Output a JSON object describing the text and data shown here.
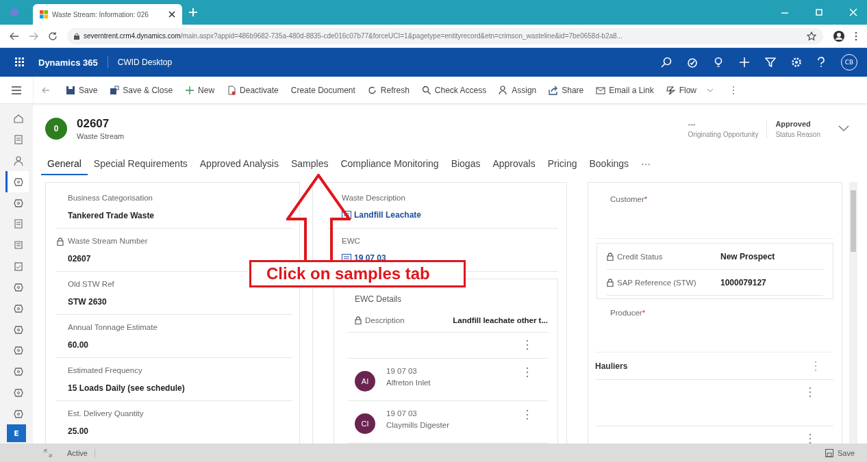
{
  "browser": {
    "tab_title": "Waste Stream: Information: 026",
    "url_host": "severntrent.crm4.dynamics.com",
    "url_path": "/main.aspx?appid=486b9682-735a-480d-8835-cde016c07b77&forceUCI=1&pagetype=entityrecord&etn=crimson_wasteline&id=7be0658d-b2a8..."
  },
  "app": {
    "name": "Dynamics 365",
    "area": "CWID Desktop",
    "avatar": "CB"
  },
  "commands": [
    {
      "label": "Save"
    },
    {
      "label": "Save & Close"
    },
    {
      "label": "New"
    },
    {
      "label": "Deactivate"
    },
    {
      "label": "Create Document"
    },
    {
      "label": "Refresh"
    },
    {
      "label": "Check Access"
    },
    {
      "label": "Assign"
    },
    {
      "label": "Share"
    },
    {
      "label": "Email a Link"
    },
    {
      "label": "Flow"
    }
  ],
  "nav": [
    {
      "selected": false
    },
    {
      "selected": false
    },
    {
      "selected": false
    },
    {
      "selected": true
    },
    {
      "selected": false
    },
    {
      "selected": false
    },
    {
      "selected": false
    },
    {
      "selected": false
    },
    {
      "selected": false
    },
    {
      "selected": false
    },
    {
      "selected": false
    },
    {
      "selected": false
    },
    {
      "selected": false
    },
    {
      "selected": false
    },
    {
      "selected": false
    }
  ],
  "area_badge": "E",
  "record": {
    "initial": "0",
    "color": "#2e7d1f",
    "title": "02607",
    "entity": "Waste Stream",
    "header_fields": [
      {
        "value": "---",
        "label": "Originating Opportunity"
      },
      {
        "value": "Approved",
        "label": "Status Reason"
      }
    ]
  },
  "tabs": [
    {
      "label": "General",
      "selected": true
    },
    {
      "label": "Special Requirements",
      "selected": false
    },
    {
      "label": "Approved Analysis",
      "selected": false
    },
    {
      "label": "Samples",
      "selected": false
    },
    {
      "label": "Compliance Monitoring",
      "selected": false
    },
    {
      "label": "Biogas",
      "selected": false
    },
    {
      "label": "Approvals",
      "selected": false
    },
    {
      "label": "Pricing",
      "selected": false
    },
    {
      "label": "Bookings",
      "selected": false
    },
    {
      "label": "···",
      "selected": false
    }
  ],
  "general_fields": [
    {
      "label": "Business Categorisation",
      "value": "Tankered Trade Waste",
      "locked": false
    },
    {
      "label": "Waste Stream Number",
      "value": "02607",
      "locked": true
    },
    {
      "label": "Old STW Ref",
      "value": "STW 2630",
      "locked": false
    },
    {
      "label": "Annual Tonnage Estimate",
      "value": "60.00",
      "locked": false
    },
    {
      "label": "Estimated Frequency",
      "value": "15 Loads Daily (see schedule)",
      "locked": false
    },
    {
      "label": "Est. Delivery Quantity",
      "value": "25.00",
      "locked": false
    }
  ],
  "waste": {
    "description_label": "Waste Description",
    "description_link": "Landfill Leachate",
    "ewc_label": "EWC",
    "ewc_link": "19 07 03",
    "ewc_details": {
      "title": "EWC Details",
      "field": {
        "label": "Description",
        "value": "Landfill leachate other t...",
        "locked": true
      },
      "items": [
        {
          "initials": "AI",
          "color": "#6b2450",
          "title": "19 07 03",
          "subtitle": "Alfreton Inlet"
        },
        {
          "initials": "CI",
          "color": "#6b2450",
          "title": "19 07 03",
          "subtitle": "Claymills Digester"
        }
      ]
    }
  },
  "customer": {
    "customer_label": "Customer",
    "customer_marker": "*",
    "sub_fields": [
      {
        "label": "Credit Status",
        "value": "New Prospect",
        "locked": true
      },
      {
        "label": "SAP Reference (STW)",
        "value": "1000079127",
        "locked": true
      }
    ],
    "producer_label": "Producer",
    "producer_marker": "*",
    "hauliers_title": "Hauliers"
  },
  "status_bar": {
    "state": "Active",
    "save": "Save"
  },
  "annotation": {
    "text": "Click on samples tab"
  }
}
